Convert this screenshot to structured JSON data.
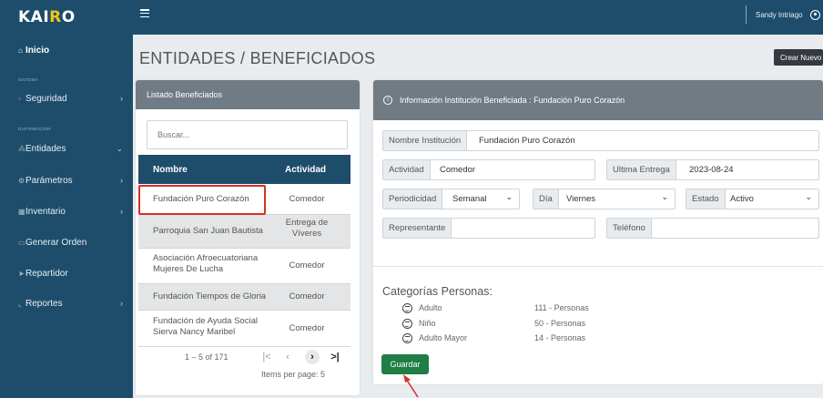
{
  "app": {
    "brand_prefix": "KAI",
    "brand_accent": "R",
    "brand_suffix": "O",
    "brand_color": "#1d4d6b",
    "accent_color": "#f0c419"
  },
  "topbar": {
    "menu_icon": "hamburger-icon",
    "user_name": "Sandy Intriago",
    "user_icon": "user-circle-icon"
  },
  "sidebar": {
    "inicio": "Inicio",
    "section_sistema": "SISTEMA",
    "seguridad": "Seguridad",
    "section_distribucion": "DISTRIBUCIÓN",
    "entidades": "Entidades",
    "parametros": "Parámetros",
    "inventario": "Inventario",
    "generar_orden": "Generar Orden",
    "repartidor": "Repartidor",
    "reportes": "Reportes"
  },
  "page": {
    "title": "ENTIDADES / BENEFICIADOS",
    "create_button": "Crear Nuevo"
  },
  "list": {
    "header": "Listado Beneficiados",
    "search_placeholder": "Buscar...",
    "columns": [
      "Nombre",
      "Actividad"
    ],
    "rows": [
      {
        "nombre": "Fundación Puro Corazón",
        "actividad": "Comedor"
      },
      {
        "nombre": "Parroquia San Juan Bautista",
        "actividad": "Entrega de Víveres"
      },
      {
        "nombre": "Asociación Afroecuatoriana Mujeres De Lucha",
        "actividad": "Comedor"
      },
      {
        "nombre": "Fundación Tiempos de Gloria",
        "actividad": "Comedor"
      },
      {
        "nombre": "Fundación de Ayuda Social Sierva Nancy Maribel",
        "actividad": "Comedor"
      }
    ],
    "range": "1 – 5 of 171",
    "items_per_page": "Items per page: 5"
  },
  "detail": {
    "header": "Información Institución Beneficiada : Fundación Puro Corazón",
    "nombre_label": "Nombre Institución",
    "nombre_value": "Fundación Puro Corazón",
    "actividad_label": "Actividad",
    "actividad_value": "Comedor",
    "ultima_label": "Ultima Entrega",
    "ultima_value": "2023-08-24",
    "periodicidad_label": "Periodicidad",
    "periodicidad_value": "Semanal",
    "dia_label": "Día",
    "dia_value": "Viernes",
    "estado_label": "Estado",
    "estado_value": "Activo",
    "representante_label": "Representante",
    "representante_value": "",
    "telefono_label": "Teléfono",
    "telefono_value": "",
    "categorias_title": "Categorías Personas:",
    "categorias": [
      {
        "name": "Adulto",
        "count": "111 - Personas"
      },
      {
        "name": "Niño",
        "count": "50 - Personas"
      },
      {
        "name": "Adulto Mayor",
        "count": "14 - Personas"
      }
    ],
    "save_button": "Guardar",
    "save_color": "#1e7e45"
  }
}
